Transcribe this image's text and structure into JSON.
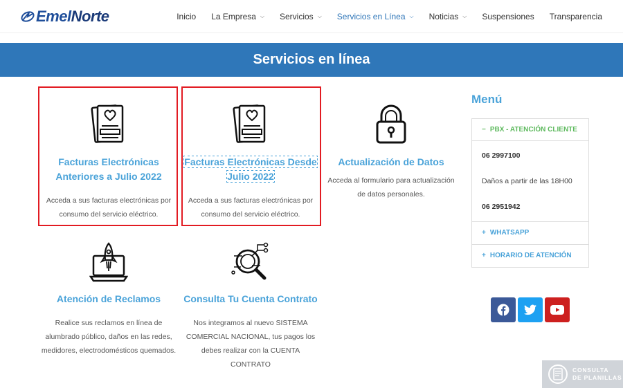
{
  "header": {
    "logo_text_a": "Emel",
    "logo_text_b": "Norte",
    "nav": [
      {
        "label": "Inicio",
        "dropdown": false
      },
      {
        "label": "La Empresa",
        "dropdown": true
      },
      {
        "label": "Servicios",
        "dropdown": true
      },
      {
        "label": "Servicios en Línea",
        "dropdown": true,
        "active": true
      },
      {
        "label": "Noticias",
        "dropdown": true
      },
      {
        "label": "Suspensiones",
        "dropdown": false
      },
      {
        "label": "Transparencia",
        "dropdown": false
      }
    ]
  },
  "banner": {
    "title": "Servicios en línea"
  },
  "services": [
    {
      "icon": "invoice-icon",
      "title": "Facturas Electrónicas Anteriores a Julio 2022",
      "desc": "Acceda a sus facturas electrónicas por consumo del servicio eléctrico."
    },
    {
      "icon": "invoice-icon",
      "title": "Facturas Electrónicas Desde Julio 2022",
      "desc": "Acceda a sus facturas electrónicas por consumo del servicio eléctrico."
    },
    {
      "icon": "padlock-icon",
      "title": "Actualización de Datos",
      "desc": "Acceda al formulario para actualización de datos personales."
    },
    {
      "icon": "rocket-laptop-icon",
      "title": "Atención de Reclamos",
      "desc": "Realice sus reclamos en línea de alumbrado público, daños en las redes, medidores, electrodomésticos quemados."
    },
    {
      "icon": "magnifier-circuit-icon",
      "title": "Consulta Tu Cuenta Contrato",
      "desc": "Nos integramos al nuevo SISTEMA COMERCIAL NACIONAL, tus pagos los debes realizar con la CUENTA CONTRATO"
    }
  ],
  "sidebar": {
    "heading": "Menú",
    "pbx_label": "PBX - ATENCIÓN CLIENTE",
    "pbx_toggle": "−",
    "phone1": "06 2997100",
    "note": "Daños a partir de las 18H00",
    "phone2": "06 2951942",
    "whatsapp_label": "WHATSAPP",
    "horario_label": "HORARIO DE ATENCIÓN",
    "expand_toggle": "+"
  },
  "social": [
    {
      "name": "facebook",
      "glyph": "f",
      "color": "#3b5998"
    },
    {
      "name": "twitter",
      "glyph": "t",
      "color": "#1da1f2"
    },
    {
      "name": "youtube",
      "glyph": "▶",
      "color": "#cd201f"
    }
  ],
  "watermark": {
    "line1": "CONSULTA",
    "line2": "DE PLANILLAS"
  },
  "colors": {
    "accent": "#2f77b9",
    "link": "#4aa3d9",
    "green": "#5db95d",
    "highlight": "#e21b22"
  }
}
